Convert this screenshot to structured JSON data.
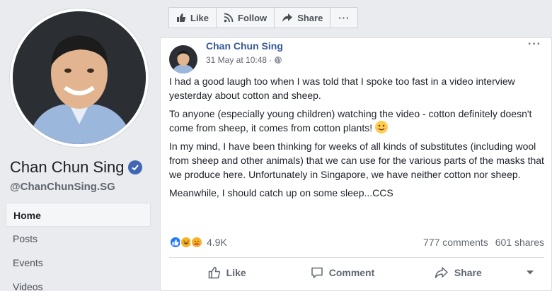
{
  "profile": {
    "name": "Chan Chun Sing",
    "handle": "@ChanChunSing.SG",
    "verified_icon": "verified-badge-icon"
  },
  "nav": {
    "items": [
      {
        "label": "Home",
        "active": true
      },
      {
        "label": "Posts"
      },
      {
        "label": "Events"
      },
      {
        "label": "Videos"
      }
    ]
  },
  "actions": {
    "like": "Like",
    "follow": "Follow",
    "share": "Share",
    "more": "···"
  },
  "post": {
    "author": "Chan Chun Sing",
    "timestamp": "31 May at 10:48",
    "privacy_icon": "globe-icon",
    "more": "···",
    "paragraphs": [
      "I had a good laugh too when I was told that I spoke too fast in a video interview yesterday about cotton and sheep.",
      "To anyone (especially young children) watching the video - cotton definitely doesn't come from sheep, it comes from cotton plants!",
      "In my mind, I have been thinking for weeks of all kinds of substitutes (including wool from sheep and other animals) that we can use for the various parts of the masks that we produce here. Unfortunately in Singapore, we have neither cotton nor sheep.",
      "Meanwhile, I should catch up on some sleep...CCS"
    ],
    "reaction_count": "4.9K",
    "comments": "777 comments",
    "shares": "601 shares",
    "buttons": {
      "like": "Like",
      "comment": "Comment",
      "share": "Share"
    }
  },
  "colors": {
    "link_blue": "#365899",
    "fb_blue": "#4267b2",
    "like_blue": "#2078f4"
  }
}
